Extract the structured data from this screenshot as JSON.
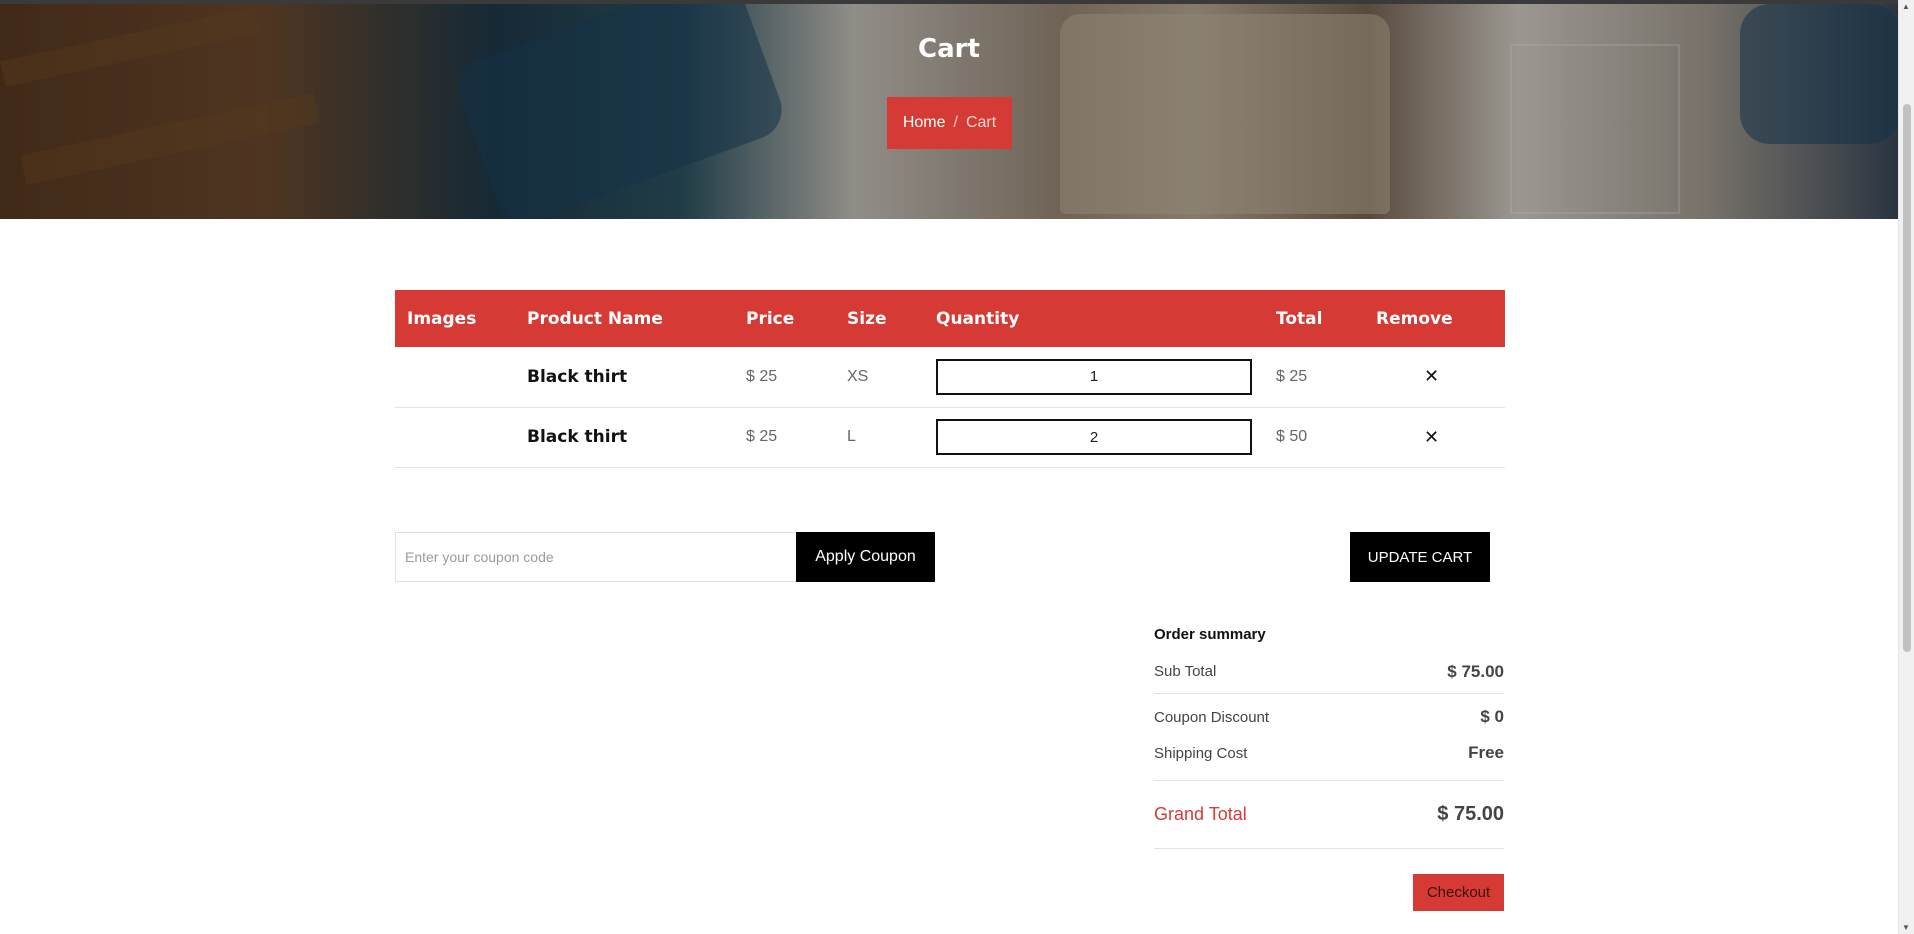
{
  "hero": {
    "title": "Cart",
    "breadcrumb": {
      "home": "Home",
      "separator": "/",
      "current": "Cart"
    }
  },
  "table": {
    "headers": [
      "Images",
      "Product Name",
      "Price",
      "Size",
      "Quantity",
      "Total",
      "Remove"
    ],
    "rows": [
      {
        "name": "Black thirt",
        "price": "$ 25",
        "size": "XS",
        "quantity": "1",
        "total": "$ 25"
      },
      {
        "name": "Black thirt",
        "price": "$ 25",
        "size": "L",
        "quantity": "2",
        "total": "$ 50"
      }
    ],
    "remove_glyph": "✕"
  },
  "coupon": {
    "placeholder": "Enter your coupon code",
    "apply_label": "Apply Coupon"
  },
  "update_label": "UPDATE CART",
  "summary": {
    "title": "Order summary",
    "subtotal_label": "Sub Total",
    "subtotal_value": "$ 75.00",
    "coupon_label": "Coupon Discount",
    "coupon_value": "$ 0",
    "shipping_label": "Shipping Cost",
    "shipping_value": "Free",
    "grand_label": "Grand Total",
    "grand_value": "$ 75.00"
  },
  "checkout_label": "Checkout",
  "colors": {
    "accent": "#d63a34",
    "dark": "#000000"
  }
}
